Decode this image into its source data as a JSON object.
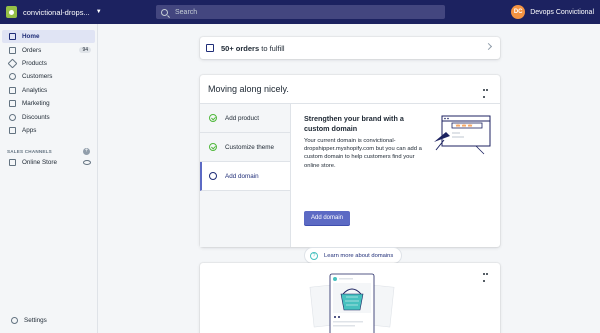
{
  "topbar": {
    "store_name": "convictional-drops...",
    "search_placeholder": "Search",
    "user_initials": "DC",
    "user_name": "Devops Convictional"
  },
  "sidebar": {
    "items": [
      {
        "label": "Home",
        "icon": "home-icon",
        "active": true
      },
      {
        "label": "Orders",
        "icon": "orders-icon",
        "badge": "94"
      },
      {
        "label": "Products",
        "icon": "tag-icon"
      },
      {
        "label": "Customers",
        "icon": "person-icon"
      },
      {
        "label": "Analytics",
        "icon": "bar-chart-icon"
      },
      {
        "label": "Marketing",
        "icon": "megaphone-icon"
      },
      {
        "label": "Discounts",
        "icon": "discount-icon"
      },
      {
        "label": "Apps",
        "icon": "apps-icon"
      }
    ],
    "channels_heading": "SALES CHANNELS",
    "online_store": "Online Store",
    "settings": "Settings"
  },
  "orders_card": {
    "count": "50+ orders",
    "suffix": " to fulfill"
  },
  "setup_card": {
    "title": "Moving along nicely.",
    "tasks": [
      {
        "label": "Add product",
        "status": "complete"
      },
      {
        "label": "Customize theme",
        "status": "complete"
      },
      {
        "label": "Add domain",
        "status": "active"
      }
    ],
    "detail_title": "Strengthen your brand with a custom domain",
    "detail_text": "Your current domain is convictional-dropshipper.myshopify.com but you can add a custom domain to help customers find your online store.",
    "primary_button": "Add domain",
    "learn_link": "Learn more about domains"
  },
  "colors": {
    "topbar": "#1c2260",
    "accent": "#5c6ac4",
    "success": "#50b83c",
    "teal": "#47c1bf"
  }
}
